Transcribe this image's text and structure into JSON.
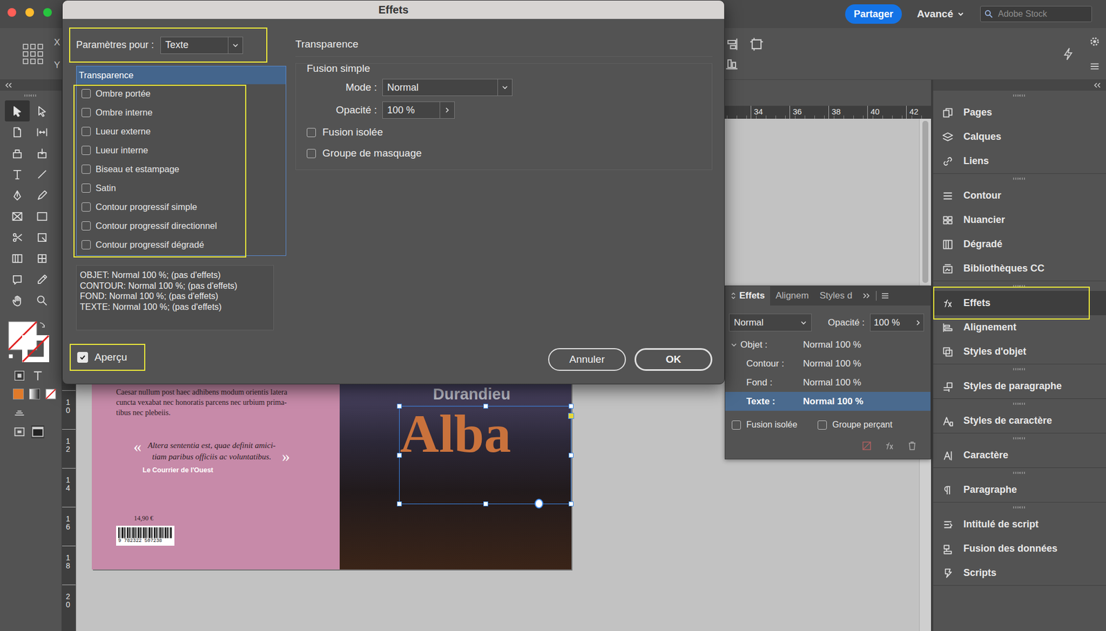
{
  "app_bar": {
    "share": "Partager",
    "workspace": "Avancé",
    "search_placeholder": "Adobe Stock"
  },
  "control_bar": {
    "coords": [
      "X",
      "Y"
    ]
  },
  "toolbar": {
    "tools": [
      {
        "selected": true
      },
      {
        "selected": false
      },
      {
        "selected": false
      },
      {
        "selected": false
      },
      {
        "selected": false
      },
      {
        "selected": false
      },
      {
        "selected": false
      },
      {
        "selected": false
      },
      {
        "selected": false
      },
      {
        "selected": false
      },
      {
        "selected": false
      },
      {
        "selected": false
      },
      {
        "selected": false
      },
      {
        "selected": false
      },
      {
        "selected": false
      },
      {
        "selected": false
      },
      {
        "selected": false
      },
      {
        "selected": false
      },
      {
        "selected": false
      },
      {
        "selected": false
      }
    ]
  },
  "rulers": {
    "horizontal": [
      "34",
      "36",
      "38",
      "40",
      "42"
    ],
    "vertical": [
      "10",
      "12",
      "14",
      "16",
      "18",
      "20"
    ]
  },
  "document": {
    "back_cover": {
      "body": [
        "Caesar nullum post haec adhibens modum orientis latera",
        "cuncta vexabat nec honoratis parcens nec urbium prima-",
        "tibus nec plebeiis."
      ],
      "quote_marks": [
        "«",
        "»"
      ],
      "quote": [
        "Altera sententia est, quae definit amici-",
        "tiam paribus officiis ac voluntatibus."
      ],
      "source": "Le Courrier de l'Ouest",
      "price": "14,90 €",
      "isbn": "9 782322 507238"
    },
    "front_cover": {
      "author": "Durandieu",
      "title": "Alba",
      "selected": true
    }
  },
  "dock": {
    "groups": [
      [
        {
          "label": "Pages",
          "selected": false
        },
        {
          "label": "Calques",
          "selected": false
        },
        {
          "label": "Liens",
          "selected": false
        }
      ],
      [
        {
          "label": "Contour",
          "selected": false
        },
        {
          "label": "Nuancier",
          "selected": false
        },
        {
          "label": "Dégradé",
          "selected": false
        },
        {
          "label": "Bibliothèques CC",
          "selected": false
        }
      ],
      [
        {
          "label": "Effets",
          "selected": true
        },
        {
          "label": "Alignement",
          "selected": false
        },
        {
          "label": "Styles d'objet",
          "selected": false
        }
      ],
      [
        {
          "label": "Styles de paragraphe",
          "selected": false
        }
      ],
      [
        {
          "label": "Styles de caractère",
          "selected": false
        }
      ],
      [
        {
          "label": "Caractère",
          "selected": false
        }
      ],
      [
        {
          "label": "Paragraphe",
          "selected": false
        }
      ],
      [
        {
          "label": "Intitulé de script",
          "selected": false
        },
        {
          "label": "Fusion des données",
          "selected": false
        },
        {
          "label": "Scripts",
          "selected": false
        }
      ]
    ]
  },
  "effects_panel": {
    "tabs": [
      {
        "label": "Effets",
        "selected": true
      },
      {
        "label": "Alignem",
        "selected": false
      },
      {
        "label": "Styles d",
        "selected": false
      }
    ],
    "mode": "Normal",
    "opacity": {
      "label": "Opacité :",
      "value": "100 %"
    },
    "rows": [
      {
        "label": "Objet :",
        "value": "Normal 100 %",
        "kind": "parent",
        "expanded": true,
        "selected": false
      },
      {
        "label": "Contour :",
        "value": "Normal 100 %",
        "kind": "child",
        "expanded": false,
        "selected": false
      },
      {
        "label": "Fond :",
        "value": "Normal 100 %",
        "kind": "child",
        "expanded": false,
        "selected": false
      },
      {
        "label": "Texte :",
        "value": "Normal 100 %",
        "kind": "child",
        "expanded": false,
        "selected": true
      }
    ],
    "options": [
      {
        "label": "Fusion isolée",
        "checked": false
      },
      {
        "label": "Groupe perçant",
        "checked": false
      }
    ]
  },
  "dialog": {
    "title": "Effets",
    "settings_for": {
      "label": "Paramètres pour :",
      "value": "Texte"
    },
    "category_header": {
      "label": "Transparence",
      "selected": true
    },
    "effects": [
      {
        "label": "Ombre portée",
        "checked": false
      },
      {
        "label": "Ombre interne",
        "checked": false
      },
      {
        "label": "Lueur externe",
        "checked": false
      },
      {
        "label": "Lueur interne",
        "checked": false
      },
      {
        "label": "Biseau et estampage",
        "checked": false
      },
      {
        "label": "Satin",
        "checked": false
      },
      {
        "label": "Contour progressif simple",
        "checked": false
      },
      {
        "label": "Contour progressif directionnel",
        "checked": false
      },
      {
        "label": "Contour progressif dégradé",
        "checked": false
      }
    ],
    "summary": [
      "OBJET: Normal 100 %; (pas d'effets)",
      "CONTOUR: Normal 100 %; (pas d'effets)",
      "FOND: Normal 100 %; (pas d'effets)",
      "TEXTE: Normal 100 %; (pas d'effets)"
    ],
    "preview": {
      "label": "Aperçu",
      "checked": true
    },
    "section_title": "Transparence",
    "group_title": "Fusion simple",
    "mode": {
      "label": "Mode :",
      "value": "Normal"
    },
    "opacity": {
      "label": "Opacité :",
      "value": "100 %"
    },
    "options": [
      {
        "label": "Fusion isolée",
        "checked": false
      },
      {
        "label": "Groupe de masquage",
        "checked": false
      }
    ],
    "buttons": [
      {
        "label": "Annuler",
        "default": false
      },
      {
        "label": "OK",
        "default": true
      }
    ]
  }
}
